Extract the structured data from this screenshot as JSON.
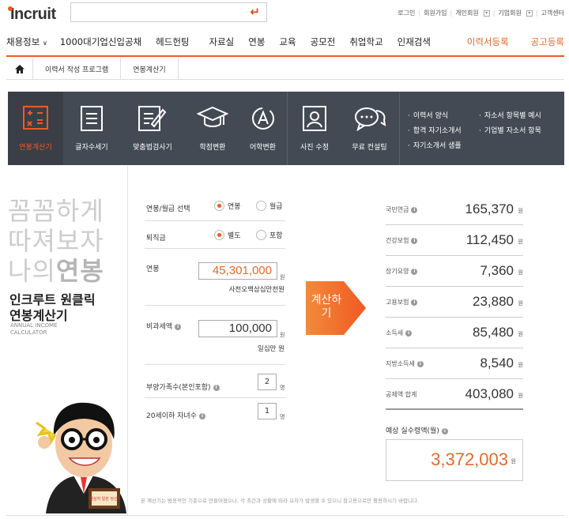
{
  "header": {
    "logo": "Incruit",
    "search_placeholder": "",
    "top_links": [
      "로그인",
      "회원가입",
      "개인회원",
      "기업회원",
      "고객센터"
    ]
  },
  "nav": {
    "items": [
      "채용정보",
      "1000대기업신입공채",
      "헤드헌팅",
      "자료실",
      "연봉",
      "교육",
      "공모전",
      "취업학교",
      "인재검색"
    ],
    "right_items": [
      "이력서등록",
      "공고등록"
    ]
  },
  "breadcrumb": [
    "이력서 작성 프로그램",
    "연봉계산기"
  ],
  "tools": [
    {
      "label": "연봉계산기",
      "icon": "calculator-icon"
    },
    {
      "label": "글자수세기",
      "icon": "document-icon"
    },
    {
      "label": "맞춤법검사기",
      "icon": "edit-document-icon"
    },
    {
      "label": "학점변환",
      "icon": "graduation-cap-icon"
    },
    {
      "label": "어학변환",
      "icon": "language-icon"
    },
    {
      "label": "사진 수정",
      "icon": "portrait-icon"
    },
    {
      "label": "무료 컨설팅",
      "icon": "chat-icon"
    }
  ],
  "tool_links_left": [
    "이력서 양식",
    "합격 자기소개서",
    "자기소개서 샘플"
  ],
  "tool_links_right": [
    "자소서 항목별 예시",
    "기업별 자소서 항목"
  ],
  "left_panel": {
    "tagline_lines": [
      "꼼꼼하게",
      "따져보자",
      "나의"
    ],
    "tagline_bold": "연봉",
    "title_lines": [
      "인크루트 원클릭",
      "연봉계산기"
    ],
    "english_lines": [
      "ANNUAL INCOME",
      "CALCULATOR"
    ],
    "book_text": "열심히 일한 당신!"
  },
  "form": {
    "pay_type": {
      "label": "연봉/월급 선택",
      "options": [
        "연봉",
        "월급"
      ],
      "selected": "연봉"
    },
    "severance": {
      "label": "퇴직금",
      "options": [
        "별도",
        "포함"
      ],
      "selected": "별도"
    },
    "salary": {
      "label": "연봉",
      "value": "45,301,000",
      "unit": "원",
      "hangul": "사천오백삼십만천원"
    },
    "nontax": {
      "label": "비과세액",
      "value": "100,000",
      "unit": "원",
      "hangul": "일십만 원"
    },
    "dependents": {
      "label": "부양가족수(본인포함)",
      "value": "2",
      "unit": "명"
    },
    "children": {
      "label": "20세이하 자녀수",
      "value": "1",
      "unit": "명"
    }
  },
  "calc_button": "계산하기",
  "results": [
    {
      "name": "국민연금",
      "value": "165,370"
    },
    {
      "name": "건강보험",
      "value": "112,450"
    },
    {
      "name": "장기요양",
      "value": "7,360"
    },
    {
      "name": "고용보험",
      "value": "23,880"
    },
    {
      "name": "소득세",
      "value": "85,480"
    },
    {
      "name": "지방소득세",
      "value": "8,540"
    },
    {
      "name": "공제액 합계",
      "value": "403,080"
    }
  ],
  "unit_won": "원",
  "net": {
    "label": "예상 실수령액(월)",
    "value": "3,372,003",
    "unit": "원"
  },
  "footnote": "본 계산기는 범용적인 기준으로 만들어졌으나, 각 조건과 상황에 따라 오차가 발생할 수 있으니 참고용으로만 활용하시기 바랍니다.",
  "colors": {
    "accent": "#f05a22",
    "toolbar": "#434a54"
  }
}
